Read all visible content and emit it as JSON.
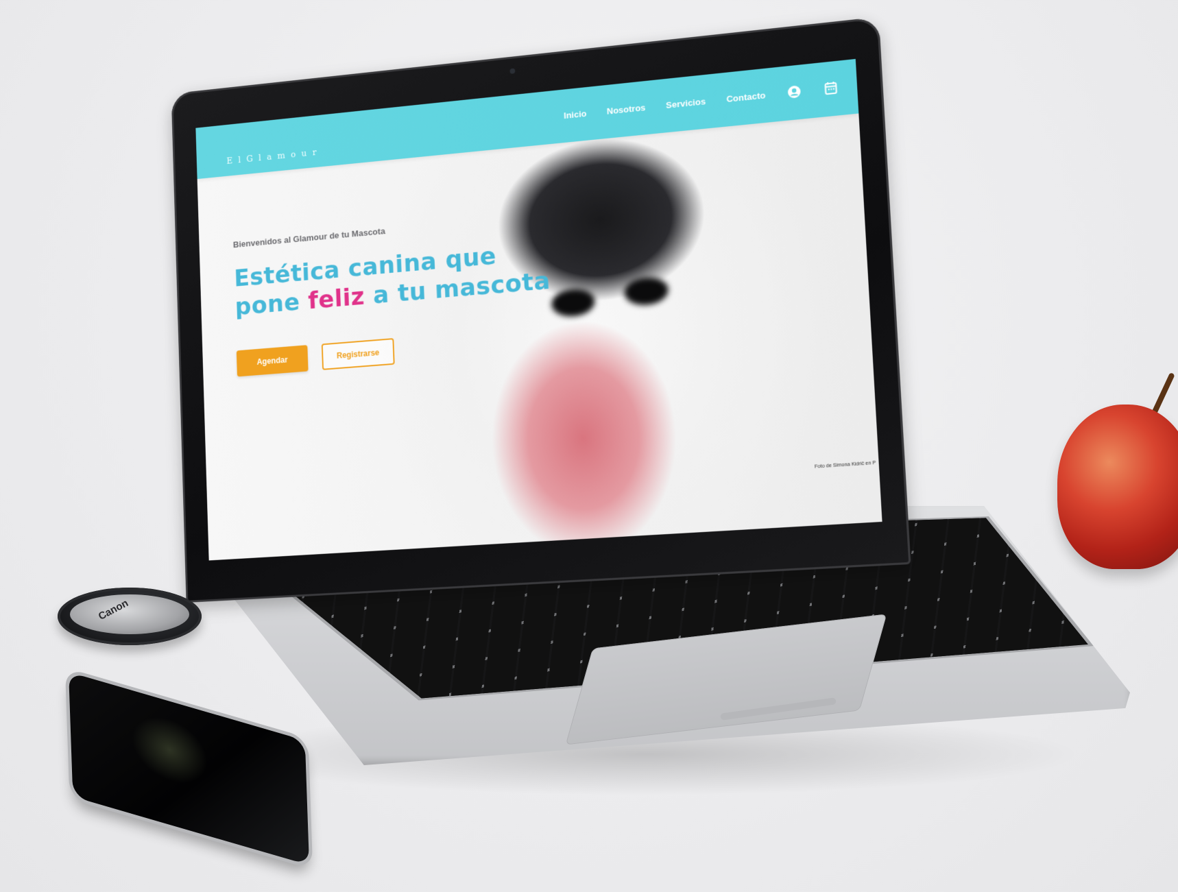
{
  "site": {
    "logo": "ElGlamour",
    "nav": [
      "Inicio",
      "Nosotros",
      "Servicios",
      "Contacto"
    ],
    "icons": [
      "user-circle-icon",
      "calendar-icon"
    ],
    "colors": {
      "header": "#5cd3df",
      "title": "#46b8d8",
      "accent": "#e0328a",
      "button": "#f0a11f"
    }
  },
  "hero": {
    "welcome": "Bienvenidos al Glamour de tu Mascota",
    "title_line1": "Estética canina que",
    "title_line2_start": "pone ",
    "title_accent": "feliz",
    "title_line2_end": " a tu mascota",
    "btn_primary": "Agendar",
    "btn_secondary": "Registrarse",
    "credit": "Foto de Simona Kidrič en P"
  },
  "accessories": {
    "lens_cap_brand": "Canon"
  }
}
